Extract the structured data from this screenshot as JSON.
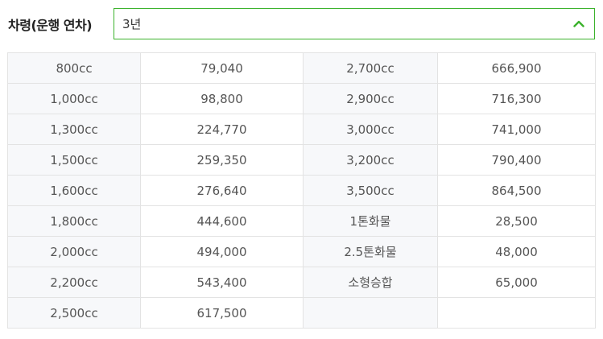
{
  "selector": {
    "label": "차령(운행 연차)",
    "selected_value": "3년",
    "chevron_icon": "chevron-up-icon",
    "accent_color": "#3cb22c"
  },
  "table": {
    "rows": [
      {
        "cc_a": "800cc",
        "price_a": "79,040",
        "cc_b": "2,700cc",
        "price_b": "666,900"
      },
      {
        "cc_a": "1,000cc",
        "price_a": "98,800",
        "cc_b": "2,900cc",
        "price_b": "716,300"
      },
      {
        "cc_a": "1,300cc",
        "price_a": "224,770",
        "cc_b": "3,000cc",
        "price_b": "741,000"
      },
      {
        "cc_a": "1,500cc",
        "price_a": "259,350",
        "cc_b": "3,200cc",
        "price_b": "790,400"
      },
      {
        "cc_a": "1,600cc",
        "price_a": "276,640",
        "cc_b": "3,500cc",
        "price_b": "864,500"
      },
      {
        "cc_a": "1,800cc",
        "price_a": "444,600",
        "cc_b": "1톤화물",
        "price_b": "28,500"
      },
      {
        "cc_a": "2,000cc",
        "price_a": "494,000",
        "cc_b": "2.5톤화물",
        "price_b": "48,000"
      },
      {
        "cc_a": "2,200cc",
        "price_a": "543,400",
        "cc_b": "소형승합",
        "price_b": "65,000"
      },
      {
        "cc_a": "2,500cc",
        "price_a": "617,500",
        "cc_b": "",
        "price_b": ""
      }
    ]
  }
}
